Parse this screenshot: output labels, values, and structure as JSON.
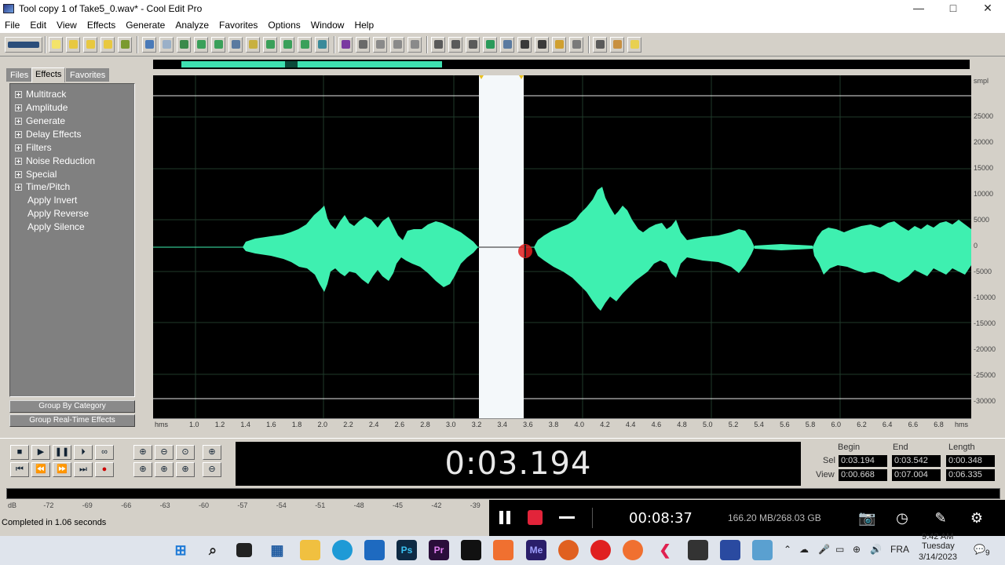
{
  "window": {
    "title": "Tool copy 1 of Take5_0.wav* - Cool Edit Pro",
    "minimize": "—",
    "maximize": "□",
    "close": "✕"
  },
  "menu": [
    "File",
    "Edit",
    "View",
    "Effects",
    "Generate",
    "Analyze",
    "Favorites",
    "Options",
    "Window",
    "Help"
  ],
  "panel": {
    "tabs": [
      "Files",
      "Effects",
      "Favorites"
    ],
    "groups": [
      "Multitrack",
      "Amplitude",
      "Generate",
      "Delay Effects",
      "Filters",
      "Noise Reduction",
      "Special",
      "Time/Pitch"
    ],
    "items": [
      "Apply Invert",
      "Apply Reverse",
      "Apply Silence"
    ],
    "group_by_category": "Group By Category",
    "group_realtime": "Group Real-Time Effects"
  },
  "waveform": {
    "amplitude_unit": "smpl",
    "amplitude_labels": [
      "25000",
      "20000",
      "15000",
      "10000",
      "5000",
      "0",
      "-5000",
      "-10000",
      "-15000",
      "-20000",
      "-25000",
      "-30000"
    ],
    "ruler_unit": "hms",
    "ruler_labels": [
      "1.0",
      "1.2",
      "1.4",
      "1.6",
      "1.8",
      "2.0",
      "2.2",
      "2.4",
      "2.6",
      "2.8",
      "3.0",
      "3.2",
      "3.4",
      "3.6",
      "3.8",
      "4.0",
      "4.2",
      "4.4",
      "4.6",
      "4.8",
      "5.0",
      "5.2",
      "5.4",
      "5.6",
      "5.8",
      "6.0",
      "6.2",
      "6.4",
      "6.6",
      "6.8"
    ],
    "colors": {
      "wave": "#3ef0b0",
      "background": "#000000",
      "selection": "#f4f8fa"
    }
  },
  "transport": {
    "time": "0:03.194",
    "headers": [
      "Begin",
      "End",
      "Length"
    ],
    "sel_label": "Sel",
    "view_label": "View",
    "sel": [
      "0:03.194",
      "0:03.542",
      "0:00.348"
    ],
    "view": [
      "0:00.668",
      "0:07.004",
      "0:06.335"
    ]
  },
  "meter": {
    "labels": [
      "dB",
      "-72",
      "-69",
      "-66",
      "-63",
      "-60",
      "-57",
      "-54",
      "-51",
      "-48",
      "-45",
      "-42",
      "-39"
    ]
  },
  "status": "Completed in 1.06 seconds",
  "recorder": {
    "elapsed": "00:08:37",
    "disk": "166.20 MB/268.03 GB"
  },
  "taskbar": {
    "lang": "FRA",
    "time": "9:42 AM",
    "day": "Tuesday",
    "date": "3/14/2023",
    "notif_count": "9"
  }
}
